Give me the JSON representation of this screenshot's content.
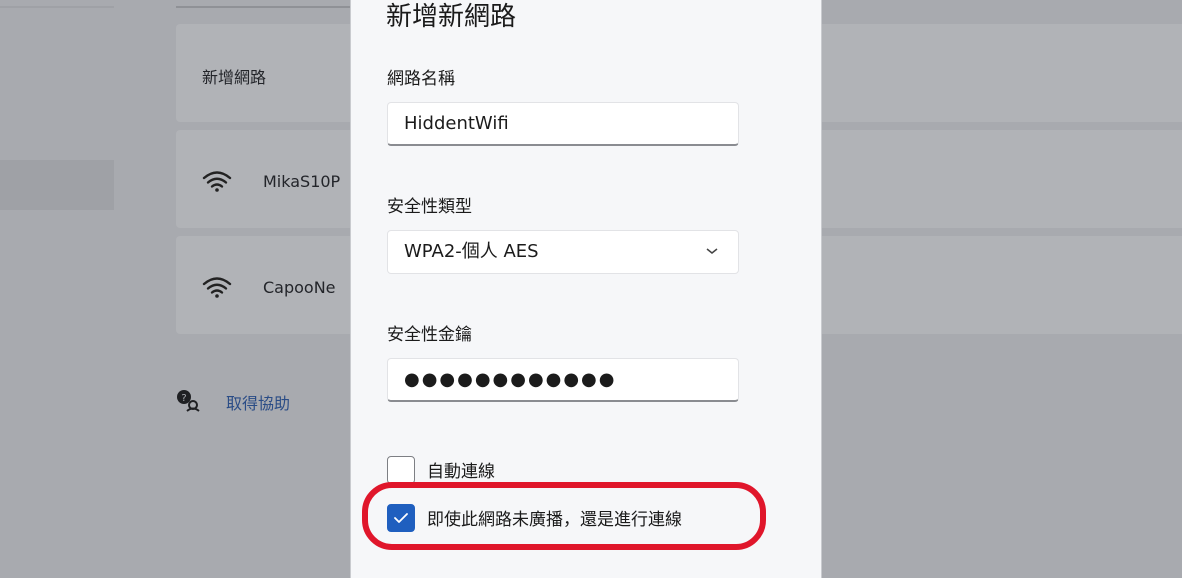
{
  "background": {
    "add_network_label": "新增網路",
    "networks": [
      {
        "name": "MikaS10P",
        "icon": "wifi-icon"
      },
      {
        "name": "CapooNe",
        "icon": "wifi-icon"
      }
    ],
    "help_link": "取得協助",
    "help_icon": "help-person-icon"
  },
  "dialog": {
    "title": "新增新網路",
    "network_name_label": "網路名稱",
    "network_name_value": "HiddentWifi",
    "security_type_label": "安全性類型",
    "security_type_value": "WPA2-個人 AES",
    "security_key_label": "安全性金鑰",
    "security_key_value": "●●●●●●●●●●●●",
    "auto_connect_label": "自動連線",
    "auto_connect_checked": false,
    "connect_hidden_label": "即使此網路未廣播，還是進行連線",
    "connect_hidden_checked": true
  },
  "colors": {
    "accent": "#1f5fbf",
    "highlight": "#e0162b",
    "overlay": "#a8aaaf"
  }
}
